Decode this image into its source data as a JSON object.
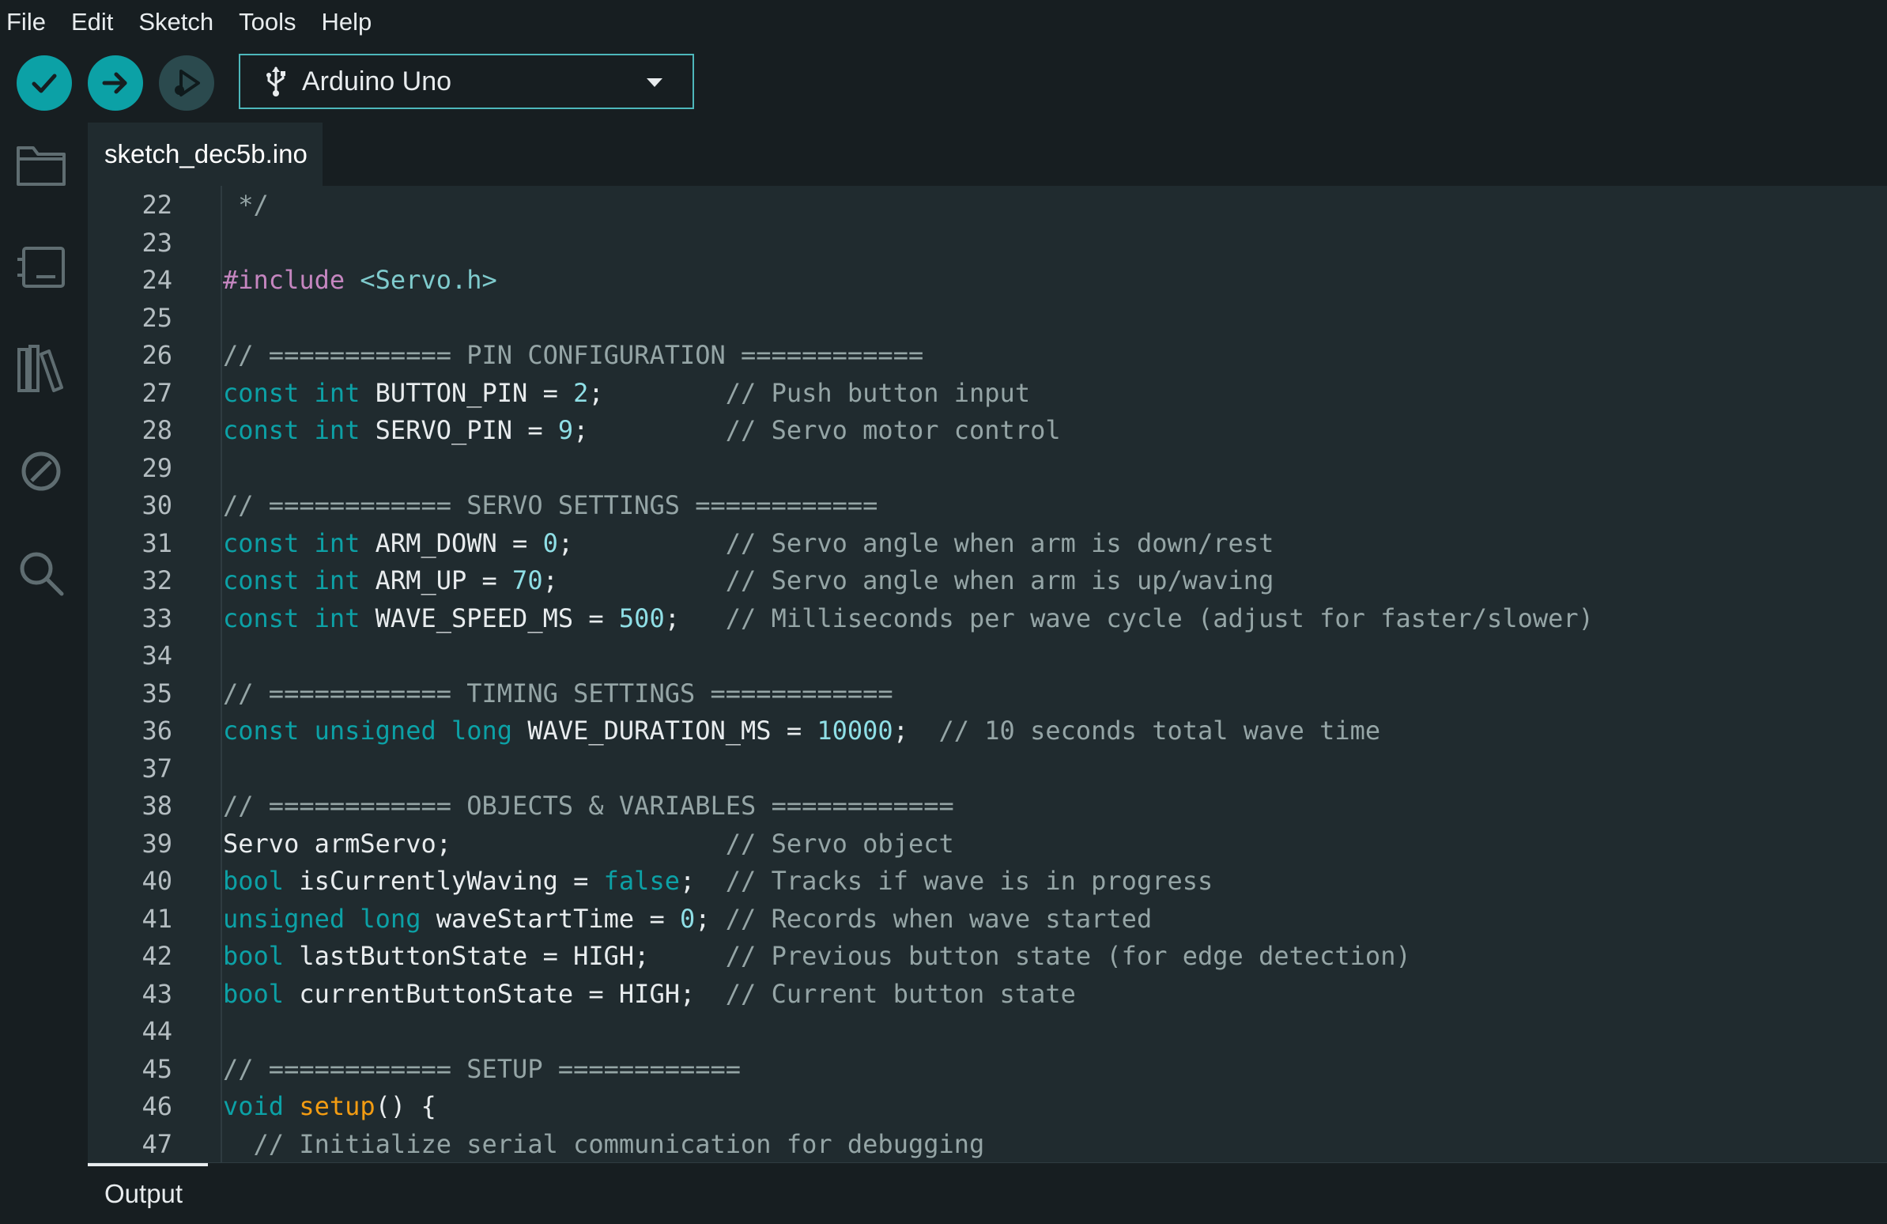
{
  "menu": [
    "File",
    "Edit",
    "Sketch",
    "Tools",
    "Help"
  ],
  "toolbar": {
    "board_name": "Arduino Uno"
  },
  "tab": {
    "label": "sketch_dec5b.ino"
  },
  "output": {
    "label": "Output"
  },
  "colors": {
    "accent": "#0ca1a6",
    "editor_bg": "#202b2f",
    "chrome_bg": "#171e21"
  },
  "editor": {
    "lines": [
      {
        "n": "22",
        "seg": [
          [
            "c-comment",
            " */"
          ]
        ]
      },
      {
        "n": "23",
        "seg": []
      },
      {
        "n": "24",
        "seg": [
          [
            "c-pre",
            "#include"
          ],
          [
            "",
            " "
          ],
          [
            "c-inc",
            "<Servo.h>"
          ]
        ]
      },
      {
        "n": "25",
        "seg": []
      },
      {
        "n": "26",
        "seg": [
          [
            "c-comment",
            "// ============ PIN CONFIGURATION ============"
          ]
        ]
      },
      {
        "n": "27",
        "seg": [
          [
            "c-kw",
            "const"
          ],
          [
            "",
            " "
          ],
          [
            "c-kw",
            "int"
          ],
          [
            "",
            " BUTTON_PIN = "
          ],
          [
            "c-num",
            "2"
          ],
          [
            "",
            ";        "
          ],
          [
            "c-comment",
            "// Push button input"
          ]
        ]
      },
      {
        "n": "28",
        "seg": [
          [
            "c-kw",
            "const"
          ],
          [
            "",
            " "
          ],
          [
            "c-kw",
            "int"
          ],
          [
            "",
            " SERVO_PIN = "
          ],
          [
            "c-num",
            "9"
          ],
          [
            "",
            ";         "
          ],
          [
            "c-comment",
            "// Servo motor control"
          ]
        ]
      },
      {
        "n": "29",
        "seg": []
      },
      {
        "n": "30",
        "seg": [
          [
            "c-comment",
            "// ============ SERVO SETTINGS ============"
          ]
        ]
      },
      {
        "n": "31",
        "seg": [
          [
            "c-kw",
            "const"
          ],
          [
            "",
            " "
          ],
          [
            "c-kw",
            "int"
          ],
          [
            "",
            " ARM_DOWN = "
          ],
          [
            "c-num",
            "0"
          ],
          [
            "",
            ";          "
          ],
          [
            "c-comment",
            "// Servo angle when arm is down/rest"
          ]
        ]
      },
      {
        "n": "32",
        "seg": [
          [
            "c-kw",
            "const"
          ],
          [
            "",
            " "
          ],
          [
            "c-kw",
            "int"
          ],
          [
            "",
            " ARM_UP = "
          ],
          [
            "c-num",
            "70"
          ],
          [
            "",
            ";           "
          ],
          [
            "c-comment",
            "// Servo angle when arm is up/waving"
          ]
        ]
      },
      {
        "n": "33",
        "seg": [
          [
            "c-kw",
            "const"
          ],
          [
            "",
            " "
          ],
          [
            "c-kw",
            "int"
          ],
          [
            "",
            " WAVE_SPEED_MS = "
          ],
          [
            "c-num",
            "500"
          ],
          [
            "",
            ";   "
          ],
          [
            "c-comment",
            "// Milliseconds per wave cycle (adjust for faster/slower)"
          ]
        ]
      },
      {
        "n": "34",
        "seg": []
      },
      {
        "n": "35",
        "seg": [
          [
            "c-comment",
            "// ============ TIMING SETTINGS ============"
          ]
        ]
      },
      {
        "n": "36",
        "seg": [
          [
            "c-kw",
            "const"
          ],
          [
            "",
            " "
          ],
          [
            "c-kw",
            "unsigned"
          ],
          [
            "",
            " "
          ],
          [
            "c-kw",
            "long"
          ],
          [
            "",
            " WAVE_DURATION_MS = "
          ],
          [
            "c-num",
            "10000"
          ],
          [
            "",
            ";  "
          ],
          [
            "c-comment",
            "// 10 seconds total wave time"
          ]
        ]
      },
      {
        "n": "37",
        "seg": []
      },
      {
        "n": "38",
        "seg": [
          [
            "c-comment",
            "// ============ OBJECTS & VARIABLES ============"
          ]
        ]
      },
      {
        "n": "39",
        "seg": [
          [
            "",
            "Servo armServo;                  "
          ],
          [
            "c-comment",
            "// Servo object"
          ]
        ]
      },
      {
        "n": "40",
        "seg": [
          [
            "c-kw",
            "bool"
          ],
          [
            "",
            " isCurrentlyWaving = "
          ],
          [
            "c-kw",
            "false"
          ],
          [
            "",
            ";  "
          ],
          [
            "c-comment",
            "// Tracks if wave is in progress"
          ]
        ]
      },
      {
        "n": "41",
        "seg": [
          [
            "c-kw",
            "unsigned"
          ],
          [
            "",
            " "
          ],
          [
            "c-kw",
            "long"
          ],
          [
            "",
            " waveStartTime = "
          ],
          [
            "c-num",
            "0"
          ],
          [
            "",
            "; "
          ],
          [
            "c-comment",
            "// Records when wave started"
          ]
        ]
      },
      {
        "n": "42",
        "seg": [
          [
            "c-kw",
            "bool"
          ],
          [
            "",
            " lastButtonState = HIGH;     "
          ],
          [
            "c-comment",
            "// Previous button state (for edge detection)"
          ]
        ]
      },
      {
        "n": "43",
        "seg": [
          [
            "c-kw",
            "bool"
          ],
          [
            "",
            " currentButtonState = HIGH;  "
          ],
          [
            "c-comment",
            "// Current button state"
          ]
        ]
      },
      {
        "n": "44",
        "seg": []
      },
      {
        "n": "45",
        "seg": [
          [
            "c-comment",
            "// ============ SETUP ============"
          ]
        ]
      },
      {
        "n": "46",
        "seg": [
          [
            "c-kw",
            "void"
          ],
          [
            "",
            " "
          ],
          [
            "c-fn",
            "setup"
          ],
          [
            "",
            "() {"
          ]
        ]
      },
      {
        "n": "47",
        "seg": [
          [
            "",
            "  "
          ],
          [
            "c-comment",
            "// Initialize serial communication for debugging"
          ]
        ]
      }
    ]
  }
}
